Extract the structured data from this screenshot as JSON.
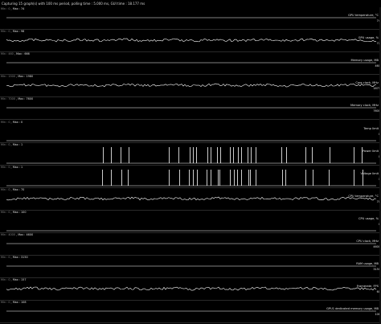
{
  "window": {
    "title": "Capturing 15 graph(s) with 100 ms period, polling time : 5.000 ms, GUI time : 18.177 ms"
  },
  "graphs": [
    {
      "min_label": "Min : 0",
      "max_label": "Max : 74",
      "name": "GPU temperature, °C",
      "current": "74",
      "trend": "flat"
    },
    {
      "min_label": "Min : 0",
      "max_label": "Max : 98",
      "name": "GPU usage, %",
      "current": "72",
      "trend": "busy"
    },
    {
      "min_label": "Min : 460",
      "max_label": "Max : 666",
      "name": "Memory usage, MB",
      "current": "460",
      "trend": "flat"
    },
    {
      "min_label": "Min : 1500",
      "max_label": "Max : 1980",
      "name": "Core clock, MHz",
      "current": "1875",
      "trend": "busy"
    },
    {
      "min_label": "Min : 7000",
      "max_label": "Max : 7600",
      "name": "Memory clock, MHz",
      "current": "7600",
      "trend": "flat"
    },
    {
      "min_label": "Min : 0",
      "max_label": "Max : 0",
      "name": "Temp limit",
      "current": "0",
      "trend": "flat"
    },
    {
      "min_label": "Min : 0",
      "max_label": "Max : 1",
      "name": "Power limit",
      "current": "0",
      "trend": "spikes"
    },
    {
      "min_label": "Min : 0",
      "max_label": "Max : 1",
      "name": "Voltage limit",
      "current": "1",
      "trend": "spikes"
    },
    {
      "min_label": "Min : 0",
      "max_label": "Max : 70",
      "name": "CPU temperature, °C",
      "current": "70",
      "trend": "busy"
    },
    {
      "min_label": "Min : 0",
      "max_label": "Max : 100",
      "name": "CPU usage, %",
      "current": "0",
      "trend": "flat"
    },
    {
      "min_label": "Min : 4000",
      "max_label": "Max : 4600",
      "name": "CPU clock, MHz",
      "current": "4600",
      "trend": "flat"
    },
    {
      "min_label": "Min : 0",
      "max_label": "Max : 3150",
      "name": "RAM usage, MB",
      "current": "3150",
      "trend": "flat"
    },
    {
      "min_label": "Min : 0",
      "max_label": "Max : 157",
      "name": "Framerate, FPS",
      "current": "60",
      "trend": "busy"
    },
    {
      "min_label": "Min : 0",
      "max_label": "Max : 108",
      "name": "GPU1 dedicated memory usage, MB",
      "current": "108",
      "trend": "flat"
    }
  ],
  "colors": {
    "background": "#000000",
    "plot": "#ffffff",
    "label": "#e0e0e0"
  }
}
